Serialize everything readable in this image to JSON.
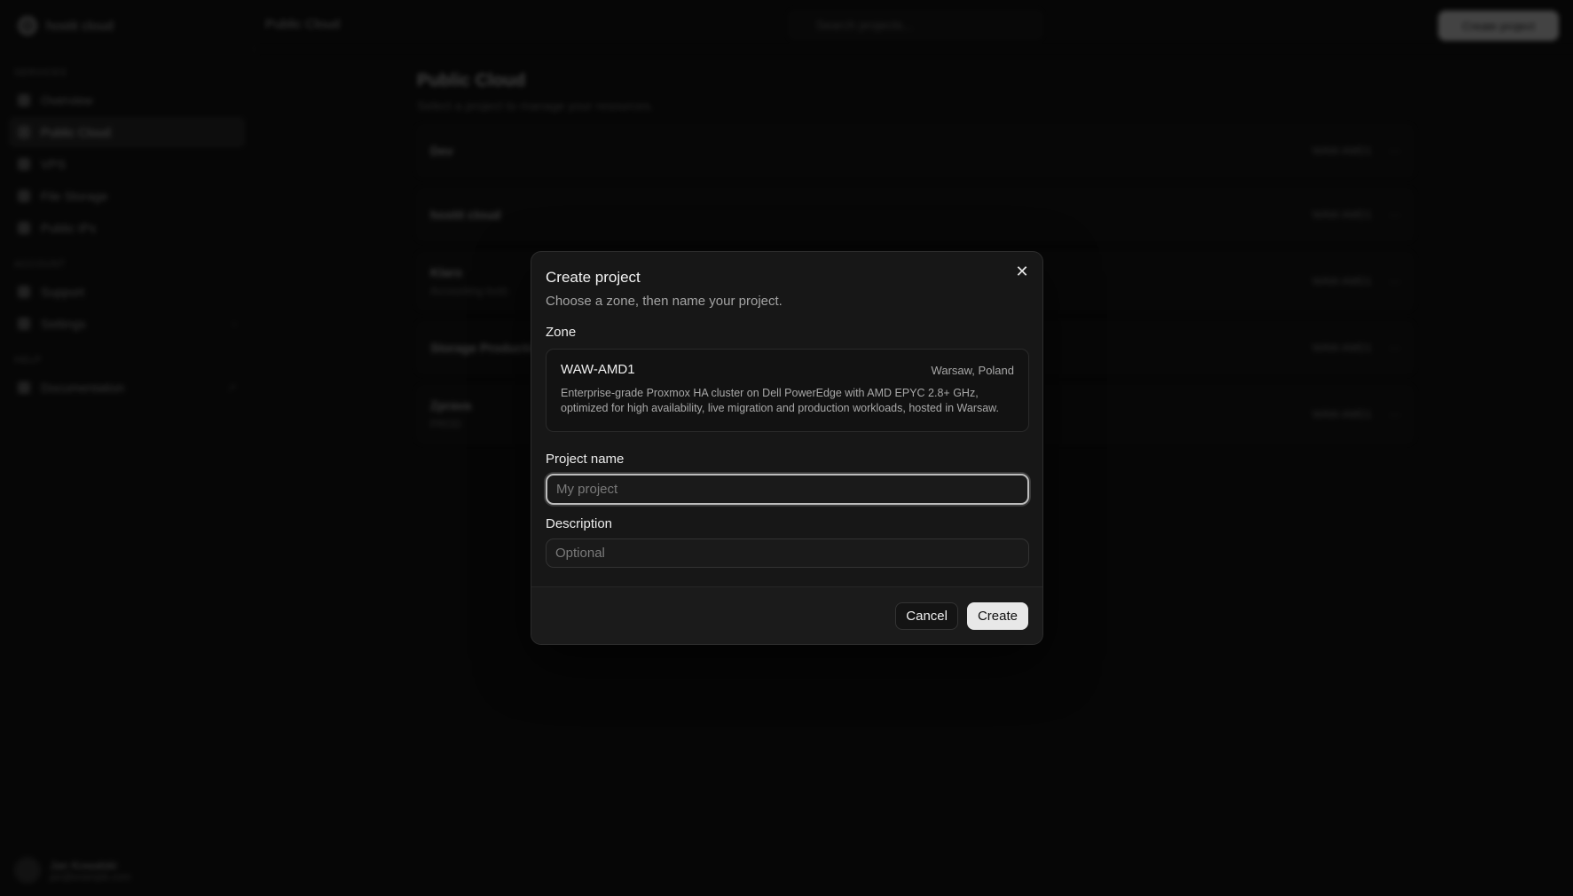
{
  "sidebar": {
    "brand": "hostit cloud",
    "sections": [
      {
        "label": "SERVICES",
        "items": [
          {
            "label": "Overview"
          },
          {
            "label": "Public Cloud",
            "active": true
          },
          {
            "label": "VPS"
          },
          {
            "label": "File Storage"
          },
          {
            "label": "Public IPs"
          }
        ]
      },
      {
        "label": "ACCOUNT",
        "items": [
          {
            "label": "Support"
          },
          {
            "label": "Settings"
          }
        ]
      },
      {
        "label": "HELP",
        "items": [
          {
            "label": "Documentation"
          }
        ]
      }
    ],
    "user": {
      "name": "Jan Kowalski",
      "email": "jan@example.com"
    }
  },
  "topbar": {
    "breadcrumb": "Public Cloud",
    "search_placeholder": "Search projects...",
    "new_button": "Create project"
  },
  "main": {
    "title": "Public Cloud",
    "subtitle": "Select a project to manage your resources.",
    "projects": [
      {
        "name": "Dev",
        "desc": "",
        "zone": "WAW-AMD1"
      },
      {
        "name": "hostit cloud",
        "desc": "",
        "zone": "WAW-AMD1"
      },
      {
        "name": "Klaro",
        "desc": "Accounting tools",
        "zone": "WAW-AMD1"
      },
      {
        "name": "Storage Production",
        "desc": "",
        "zone": "WAW-AMD1"
      },
      {
        "name": "Zprava",
        "desc": "PROD",
        "zone": "WAW-AMD1"
      }
    ]
  },
  "modal": {
    "title": "Create project",
    "description": "Choose a zone, then name your project.",
    "zone_label": "Zone",
    "zone": {
      "name": "WAW-AMD1",
      "location": "Warsaw, Poland",
      "description": "Enterprise-grade Proxmox HA cluster on Dell PowerEdge with AMD EPYC 2.8+ GHz, optimized for high availability, live migration and production workloads, hosted in Warsaw."
    },
    "project_name_label": "Project name",
    "project_name_placeholder": "My project",
    "project_name_value": "",
    "description_label": "Description",
    "description_placeholder": "Optional",
    "description_value": "",
    "cancel_label": "Cancel",
    "create_label": "Create",
    "close_icon": "close-icon"
  }
}
